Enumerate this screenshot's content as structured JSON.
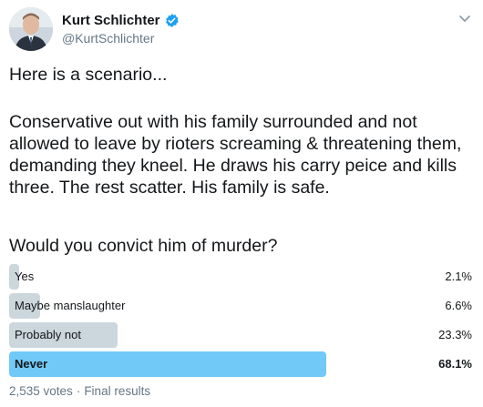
{
  "author": {
    "display_name": "Kurt Schlichter",
    "handle": "@KurtSchlichter",
    "verified": true,
    "verified_color": "#1da1f2"
  },
  "tweet": {
    "text_1": "Here is a scenario...",
    "text_2": "Conservative out with his family surrounded and not allowed to leave by rioters screaming & threatening them, demanding they kneel. He draws his carry peice and kills three. The rest scatter. His family is safe.",
    "text_3": "Would you convict him of murder?"
  },
  "poll": {
    "options": [
      {
        "label": "Yes",
        "percent_text": "2.1%",
        "percent": 2.1,
        "winner": false
      },
      {
        "label": "Maybe manslaughter",
        "percent_text": "6.6%",
        "percent": 6.6,
        "winner": false
      },
      {
        "label": "Probably not",
        "percent_text": "23.3%",
        "percent": 23.3,
        "winner": false
      },
      {
        "label": "Never",
        "percent_text": "68.1%",
        "percent": 68.1,
        "winner": true
      }
    ],
    "votes": "2,535 votes",
    "separator": "·",
    "status": "Final results",
    "bar_color": "#ccd6dd",
    "winner_color": "#71c9f8"
  },
  "icons": {
    "avatar": "avatar-photo",
    "verified": "verified-badge-icon",
    "more": "chevron-down-icon"
  }
}
